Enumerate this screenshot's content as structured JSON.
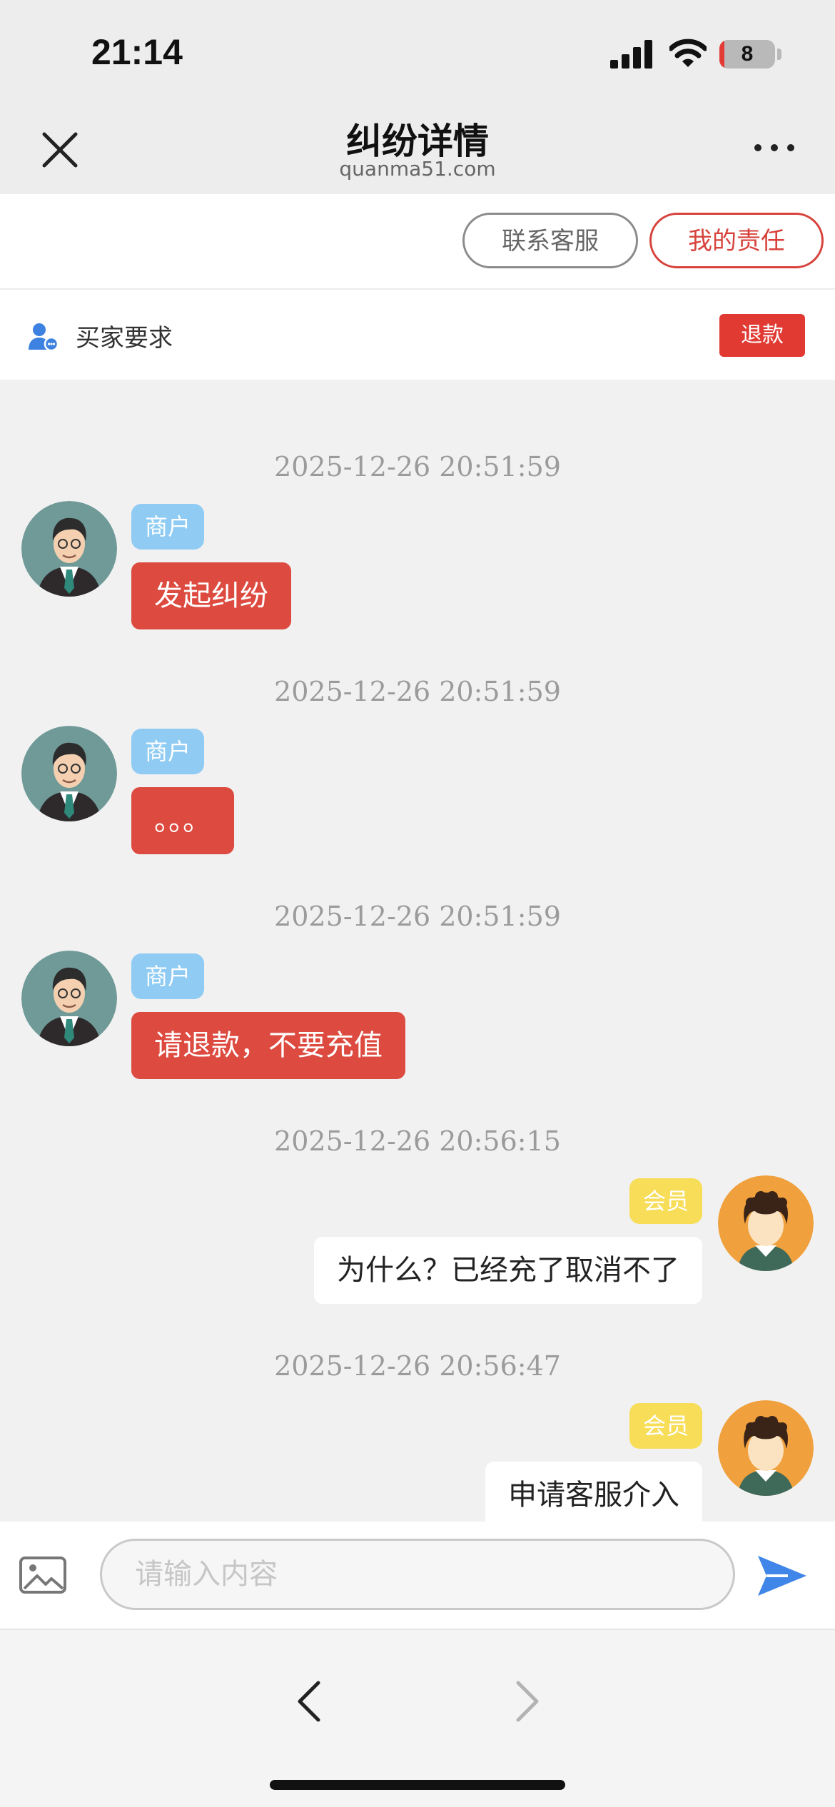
{
  "status_bar": {
    "time": "21:14",
    "battery": "8"
  },
  "nav": {
    "title": "纠纷详情",
    "subtitle": "quanma51.com"
  },
  "actions": {
    "contact_label": "联系客服",
    "responsibility_label": "我的责任"
  },
  "request": {
    "label": "买家要求",
    "badge": "退款"
  },
  "messages": [
    {
      "timestamp": "2025-12-26 20:51:59",
      "role": "商户",
      "side": "left",
      "text": "发起纠纷"
    },
    {
      "timestamp": "2025-12-26 20:51:59",
      "role": "商户",
      "side": "left",
      "text": "。。。"
    },
    {
      "timestamp": "2025-12-26 20:51:59",
      "role": "商户",
      "side": "left",
      "text": "请退款，不要充值"
    },
    {
      "timestamp": "2025-12-26 20:56:15",
      "role": "会员",
      "side": "right",
      "text": "为什么？已经充了取消不了"
    },
    {
      "timestamp": "2025-12-26 20:56:47",
      "role": "会员",
      "side": "right",
      "text": "申请客服介入"
    }
  ],
  "input": {
    "placeholder": "请输入内容"
  },
  "colors": {
    "accent_red": "#dd4a3f",
    "merchant_tag": "#8fcbf3",
    "member_tag": "#f7dd58",
    "send_blue": "#3f86e8"
  },
  "icons": {
    "close": "close-icon",
    "more": "more-icon",
    "user": "user-icon",
    "image": "image-icon",
    "send": "send-icon",
    "back": "back-arrow-icon",
    "forward": "forward-arrow-icon"
  }
}
